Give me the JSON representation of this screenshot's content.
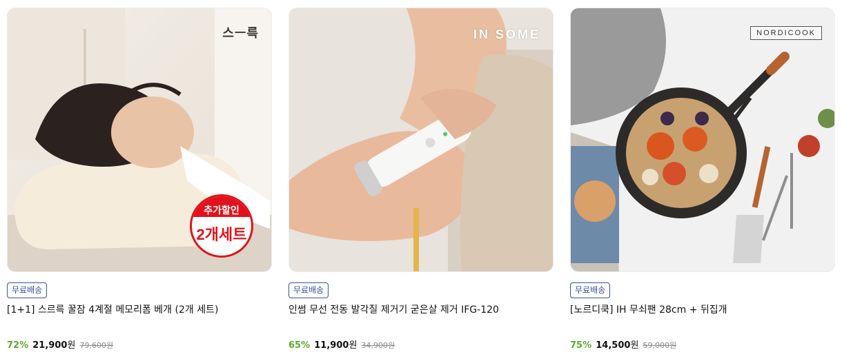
{
  "products": [
    {
      "brand_logo": "스ㅡ륵",
      "badge": {
        "top": "추가할인",
        "main": "2개세트"
      },
      "tag": "무료배송",
      "title": "[1+1] 스르륵 꿀잠 4계절 메모리폼 베개 (2개 세트)",
      "discount": "72%",
      "price": "21,900",
      "currency": "원",
      "original_price": "79,600원",
      "image_icon": "pillow-photo"
    },
    {
      "brand_logo": "IN SOME",
      "tag": "무료배송",
      "title": "인썸 무선 전동 발각질 제거기 굳은살 제거 IFG-120",
      "discount": "65%",
      "price": "11,900",
      "currency": "원",
      "original_price": "34,900원",
      "image_icon": "foot-file-photo"
    },
    {
      "brand_logo": "NORDICOOK",
      "tag": "무료배송",
      "title": "[노르디쿡] IH 무쇠팬 28cm + 뒤집개",
      "discount": "75%",
      "price": "14,500",
      "currency": "원",
      "original_price": "59,000원",
      "image_icon": "cast-iron-pan-photo"
    }
  ],
  "colors": {
    "discount": "#5aa92f",
    "tag_border": "#3c4f9d",
    "badge_red": "#e1121b"
  }
}
